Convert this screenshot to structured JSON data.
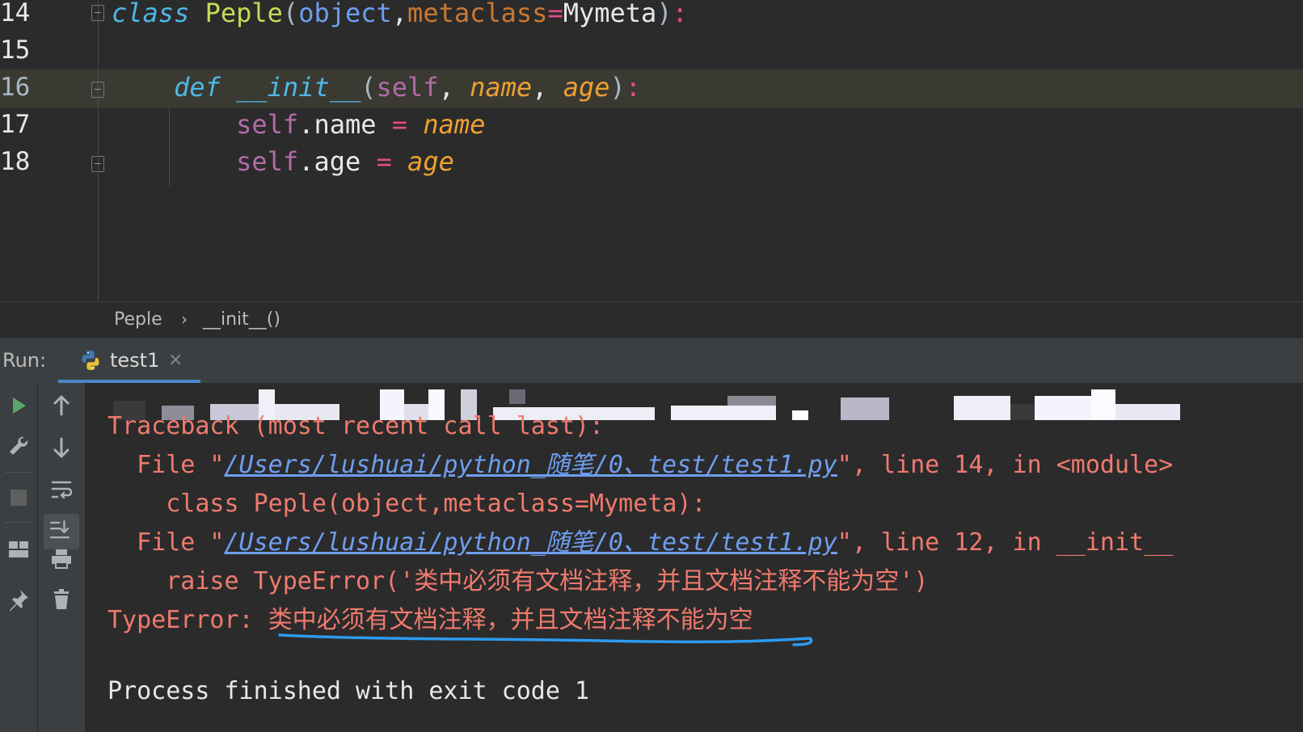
{
  "editor": {
    "lines": [
      {
        "num": "14",
        "tokens": [
          {
            "t": "class",
            "c": "k-kw"
          },
          {
            "t": " ",
            "c": "k-plain"
          },
          {
            "t": "Peple",
            "c": "k-cls"
          },
          {
            "t": "(",
            "c": "k-par"
          },
          {
            "t": "object",
            "c": "k-obj"
          },
          {
            "t": ",",
            "c": "k-plain"
          },
          {
            "t": "metaclass",
            "c": "k-kwarg"
          },
          {
            "t": "=",
            "c": "k-op"
          },
          {
            "t": "Mymeta",
            "c": "k-plain"
          },
          {
            "t": ")",
            "c": "k-par"
          },
          {
            "t": ":",
            "c": "k-op"
          }
        ]
      },
      {
        "num": "15",
        "tokens": []
      },
      {
        "num": "16",
        "tokens": [
          {
            "t": "    ",
            "c": "k-plain"
          },
          {
            "t": "def",
            "c": "k-kw"
          },
          {
            "t": " ",
            "c": "k-plain"
          },
          {
            "t": "__init__",
            "c": "k-fn"
          },
          {
            "t": "(",
            "c": "k-par"
          },
          {
            "t": "self",
            "c": "k-self"
          },
          {
            "t": ", ",
            "c": "k-plain"
          },
          {
            "t": "name",
            "c": "k-arg"
          },
          {
            "t": ", ",
            "c": "k-plain"
          },
          {
            "t": "age",
            "c": "k-arg"
          },
          {
            "t": ")",
            "c": "k-par"
          },
          {
            "t": ":",
            "c": "k-op"
          }
        ]
      },
      {
        "num": "17",
        "tokens": [
          {
            "t": "        ",
            "c": "k-plain"
          },
          {
            "t": "self",
            "c": "k-self"
          },
          {
            "t": ".name ",
            "c": "k-plain"
          },
          {
            "t": "=",
            "c": "k-op"
          },
          {
            "t": " ",
            "c": "k-plain"
          },
          {
            "t": "name",
            "c": "k-arg"
          }
        ]
      },
      {
        "num": "18",
        "tokens": [
          {
            "t": "        ",
            "c": "k-plain"
          },
          {
            "t": "self",
            "c": "k-self"
          },
          {
            "t": ".age ",
            "c": "k-plain"
          },
          {
            "t": "=",
            "c": "k-op"
          },
          {
            "t": " ",
            "c": "k-plain"
          },
          {
            "t": "age",
            "c": "k-arg"
          }
        ]
      }
    ]
  },
  "breadcrumb": {
    "items": [
      "Peple",
      "__init__()"
    ],
    "separator": "›"
  },
  "run": {
    "label": "Run:",
    "tab_label": "test1",
    "tab_close": "×"
  },
  "console": {
    "traceback": "Traceback (most recent call last):",
    "file1_prefix": "  File \"",
    "file1_path": "/Users/lushuai/python_随笔/0、test/test1.py",
    "file1_suffix": "\", line 14, in <module>",
    "code1": "    class Peple(object,metaclass=Mymeta):",
    "file2_prefix": "  File \"",
    "file2_path": "/Users/lushuai/python_随笔/0、test/test1.py",
    "file2_suffix": "\", line 12, in __init__",
    "code2": "    raise TypeError('类中必须有文档注释，并且文档注释不能为空')",
    "error_prefix": "TypeError: ",
    "error_message": "类中必须有文档注释，并且文档注释不能为空",
    "exit": "Process finished with exit code 1"
  },
  "colors": {
    "accent": "#4A88C7",
    "error_text": "#F07A6E",
    "link": "#6E9EF0",
    "annotation_underline": "#2E9BF0"
  },
  "icons": {
    "toolbar_left": [
      "run-icon",
      "wrench-icon",
      "stop-icon",
      "layout-icon",
      "pin-icon"
    ],
    "toolbar_right": [
      "up-arrow-icon",
      "down-arrow-icon",
      "soft-wrap-icon",
      "scroll-to-end-icon",
      "print-icon",
      "trash-icon"
    ]
  }
}
